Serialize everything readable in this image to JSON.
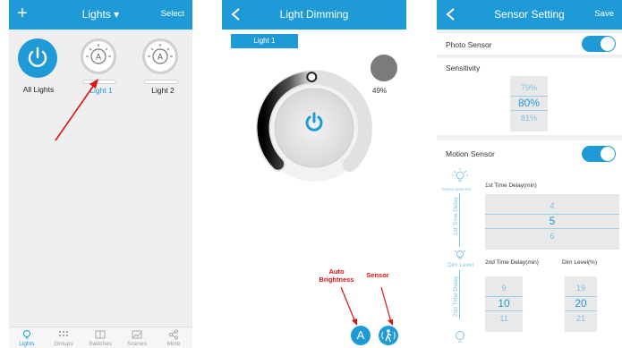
{
  "lights_screen": {
    "title": "Lights ▾",
    "action": "Select",
    "tiles": [
      {
        "label": "All Lights"
      },
      {
        "label": "Light 1"
      },
      {
        "label": "Light 2"
      }
    ],
    "tabs": [
      "Lights",
      "Groups",
      "Switches",
      "Scenes",
      "More"
    ]
  },
  "dimming_screen": {
    "title": "Light Dimming",
    "chip": "Light 1",
    "brightness_text": "49%",
    "brightness_percent": 49,
    "annotations": {
      "auto_brightness": "Auto Brightness",
      "sensor": "Sensor"
    },
    "auto_button_letter": "A"
  },
  "sensor_screen": {
    "title": "Sensor Setting",
    "action": "Save",
    "photo_sensor": {
      "label": "Photo Sensor",
      "enabled": true
    },
    "sensitivity": {
      "label": "Sensitivity",
      "values": [
        "79%",
        "80%",
        "81%"
      ]
    },
    "motion_sensor": {
      "label": "Motion Sensor",
      "enabled": true
    },
    "motion_detected_label": "Motion detected",
    "first_delay": {
      "side_label": "1st Time Delay",
      "title": "1st Time Delay(min)",
      "values": [
        "4",
        "5",
        "6"
      ]
    },
    "dim_level_label": "Dim Level",
    "second_delay": {
      "side_label": "2nd Time Delay",
      "title": "2nd Time Delay(min)",
      "values": [
        "9",
        "10",
        "11"
      ]
    },
    "dim_level": {
      "title": "Dim Level(%)",
      "values": [
        "19",
        "20",
        "21"
      ]
    }
  },
  "colors": {
    "accent": "#1e9bd7",
    "annotation_red": "#e01010",
    "light_gray": "#efefef"
  }
}
